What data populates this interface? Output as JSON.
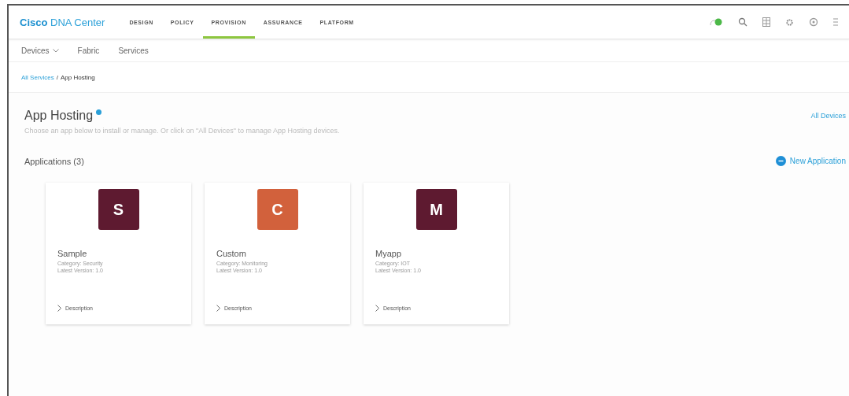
{
  "brand": {
    "first": "Cisco",
    "rest": "DNA Center"
  },
  "nav": [
    {
      "label": "DESIGN",
      "selected": false
    },
    {
      "label": "POLICY",
      "selected": false
    },
    {
      "label": "PROVISION",
      "selected": true
    },
    {
      "label": "ASSURANCE",
      "selected": false
    },
    {
      "label": "PLATFORM",
      "selected": false
    }
  ],
  "subnav": [
    {
      "label": "Devices",
      "dropdown": true
    },
    {
      "label": "Fabric",
      "dropdown": false
    },
    {
      "label": "Services",
      "dropdown": false
    }
  ],
  "breadcrumb": {
    "link": "All Services",
    "separator": "/",
    "current": "App Hosting"
  },
  "page": {
    "title": "App Hosting",
    "subtitle": "Choose an app below to install or manage. Or click on \"All Devices\" to manage App Hosting devices.",
    "all_devices": "All Devices"
  },
  "applications": {
    "heading": "Applications (3)",
    "new_button": "New Application",
    "items": [
      {
        "letter": "S",
        "color": "#5e1a30",
        "name": "Sample",
        "category": "Category: Security",
        "version": "Latest Version: 1.0",
        "link": "Description"
      },
      {
        "letter": "C",
        "color": "#d2613c",
        "name": "Custom",
        "category": "Category: Monitoring",
        "version": "Latest Version: 1.0",
        "link": "Description"
      },
      {
        "letter": "M",
        "color": "#5e1a30",
        "name": "Myapp",
        "category": "Category: IOT",
        "version": "Latest Version: 1.0",
        "link": "Description"
      }
    ]
  }
}
